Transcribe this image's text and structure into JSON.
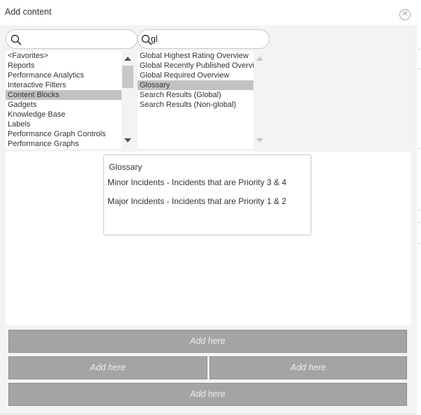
{
  "dialog": {
    "title": "Add content"
  },
  "left_search": {
    "value": "",
    "placeholder": ""
  },
  "right_search": {
    "value": "gl",
    "placeholder": ""
  },
  "categories": {
    "items": [
      {
        "label": "<Favorites>",
        "selected": false
      },
      {
        "label": "Reports",
        "selected": false
      },
      {
        "label": "Performance Analytics",
        "selected": false
      },
      {
        "label": "Interactive Filters",
        "selected": false
      },
      {
        "label": "Content Blocks",
        "selected": true
      },
      {
        "label": "Gadgets",
        "selected": false
      },
      {
        "label": "Knowledge Base",
        "selected": false
      },
      {
        "label": "Labels",
        "selected": false
      },
      {
        "label": "Performance Graph Controls",
        "selected": false
      },
      {
        "label": "Performance Graphs",
        "selected": false
      }
    ]
  },
  "content_items": {
    "items": [
      {
        "label": "Global Highest Rating Overview",
        "selected": false
      },
      {
        "label": "Global Recently Published Overview",
        "selected": false
      },
      {
        "label": "Global Required Overview",
        "selected": false
      },
      {
        "label": "Glossary",
        "selected": true
      },
      {
        "label": "Search Results (Global)",
        "selected": false
      },
      {
        "label": "Search Results (Non-global)",
        "selected": false
      }
    ]
  },
  "preview": {
    "title": "Glossary",
    "lines": [
      "Minor Incidents - Incidents that are Priority 3 & 4",
      "Major Incidents - Incidents that are Priority 1 & 2"
    ]
  },
  "dropzones": {
    "top": "Add here",
    "middle_left": "Add here",
    "middle_right": "Add here",
    "bottom": "Add here"
  },
  "icons": {
    "search": "search-icon",
    "close": "close-icon",
    "scroll_up": "chevron-up-icon",
    "scroll_down": "chevron-down-icon"
  }
}
